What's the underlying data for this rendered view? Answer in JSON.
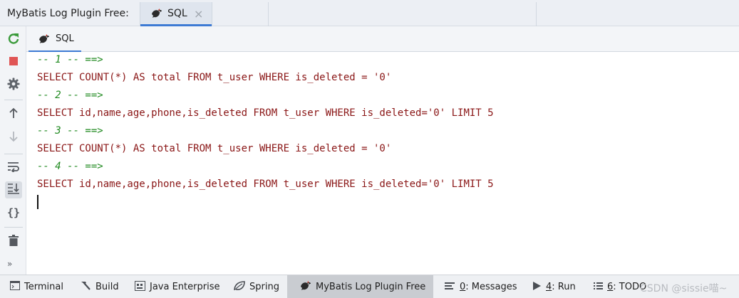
{
  "header": {
    "title": "MyBatis Log Plugin Free:",
    "tab_label": "SQL",
    "tab_close_glyph": "×"
  },
  "subtabs": [
    {
      "label": "SQL"
    }
  ],
  "toolbar": {
    "more_glyph": "»"
  },
  "console": {
    "lines": [
      {
        "kind": "comment",
        "text": "-- 1 -- ==>"
      },
      {
        "kind": "sql",
        "text": "SELECT COUNT(*) AS total FROM t_user WHERE is_deleted = '0'"
      },
      {
        "kind": "comment",
        "text": "-- 2 -- ==>"
      },
      {
        "kind": "sql",
        "text": "SELECT id,name,age,phone,is_deleted FROM t_user WHERE is_deleted='0' LIMIT 5"
      },
      {
        "kind": "comment",
        "text": "-- 3 -- ==>"
      },
      {
        "kind": "sql",
        "text": "SELECT COUNT(*) AS total FROM t_user WHERE is_deleted = '0'"
      },
      {
        "kind": "comment",
        "text": "-- 4 -- ==>"
      },
      {
        "kind": "sql",
        "text": "SELECT id,name,age,phone,is_deleted FROM t_user WHERE is_deleted='0' LIMIT 5"
      }
    ]
  },
  "statusbar": {
    "terminal": "Terminal",
    "build": "Build",
    "java_enterprise": "Java Enterprise",
    "spring": "Spring",
    "mybatis": "MyBatis Log Plugin Free",
    "messages_key": "0",
    "messages_label": ": Messages",
    "run_key": "4",
    "run_label": ": Run",
    "todo_key": "6",
    "todo_label": ": TODO",
    "watermark": "CSDN @sissie喵~"
  },
  "colors": {
    "accent": "#3d7ad4",
    "comment": "#208a20",
    "sql": "#8a1616",
    "rerun_green": "#3a9a3a",
    "stop_red": "#e05555"
  }
}
